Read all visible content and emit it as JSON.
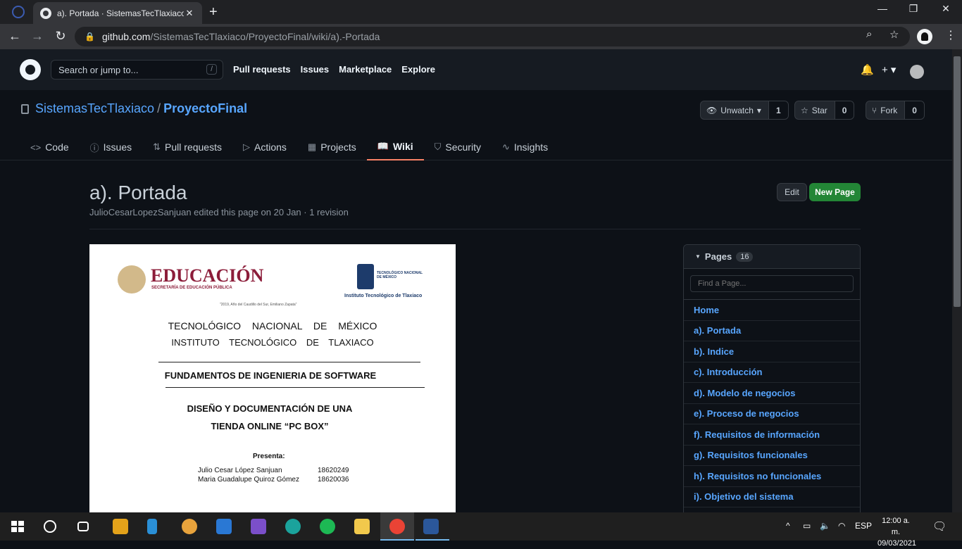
{
  "browser": {
    "tab_title": "a). Portada · SistemasTecTlaxiaco/",
    "tab_close": "✕",
    "new_tab": "+",
    "url_host": "github.com",
    "url_path": "/SistemasTecTlaxiaco/ProyectoFinal/wiki/a).-Portada"
  },
  "github": {
    "search_placeholder": "Search or jump to...",
    "search_hint": "/",
    "nav": [
      "Pull requests",
      "Issues",
      "Marketplace",
      "Explore"
    ]
  },
  "repo": {
    "owner": "SistemasTecTlaxiaco",
    "separator": "/",
    "name": "ProyectoFinal",
    "unwatch_label": "Unwatch",
    "unwatch_count": "1",
    "star_label": "Star",
    "star_count": "0",
    "fork_label": "Fork",
    "fork_count": "0",
    "tabs": [
      {
        "label": "Code",
        "icon": "<>"
      },
      {
        "label": "Issues",
        "icon": "ⓘ"
      },
      {
        "label": "Pull requests",
        "icon": "⇅"
      },
      {
        "label": "Actions",
        "icon": "▷"
      },
      {
        "label": "Projects",
        "icon": "▦"
      },
      {
        "label": "Wiki",
        "icon": "📖"
      },
      {
        "label": "Security",
        "icon": "⛉"
      },
      {
        "label": "Insights",
        "icon": "∿"
      }
    ]
  },
  "page": {
    "title": "a). Portada",
    "meta": "JulioCesarLopezSanjuan edited this page on 20 Jan · 1 revision",
    "edit_label": "Edit",
    "new_page_label": "New Page"
  },
  "document": {
    "educacion": "EDUCACIÓN",
    "educacion_sub": "SECRETARÍA DE EDUCACIÓN PÚBLICA",
    "tnm": "TECNOLÓGICO NACIONAL DE MÉXICO",
    "itt_caption": "Instituto Tecnológico de Tlaxiaco",
    "motto": "\"2019, Año del Caudillo del Sur, Emiliano Zapata\"",
    "line1": "TECNOLÓGICO NACIONAL DE MÉXICO",
    "line2": "INSTITUTO TECNOLÓGICO DE TLAXIACO",
    "line3": "FUNDAMENTOS DE INGENIERIA DE SOFTWARE",
    "line4": "DISEÑO Y DOCUMENTACIÓN DE UNA",
    "line5": "TIENDA ONLINE “PC BOX”",
    "presenta": "Presenta:",
    "authors": [
      {
        "name": "Julio Cesar López Sanjuan",
        "id": "18620249"
      },
      {
        "name": "Maria Guadalupe Quiroz Gómez",
        "id": "18620036"
      }
    ]
  },
  "sidebar": {
    "title": "Pages",
    "count": "16",
    "find_placeholder": "Find a Page...",
    "items": [
      "Home",
      "a). Portada",
      "b). Indice",
      "c). Introducción",
      "d). Modelo de negocios",
      "e). Proceso de negocios",
      "f). Requisitos de información",
      "g). Requisitos funcionales",
      "h). Requisitos no funcionales",
      "i). Objetivo del sistema"
    ]
  },
  "taskbar": {
    "lang": "ESP",
    "time": "12:00 a. m.",
    "date": "09/03/2021"
  }
}
